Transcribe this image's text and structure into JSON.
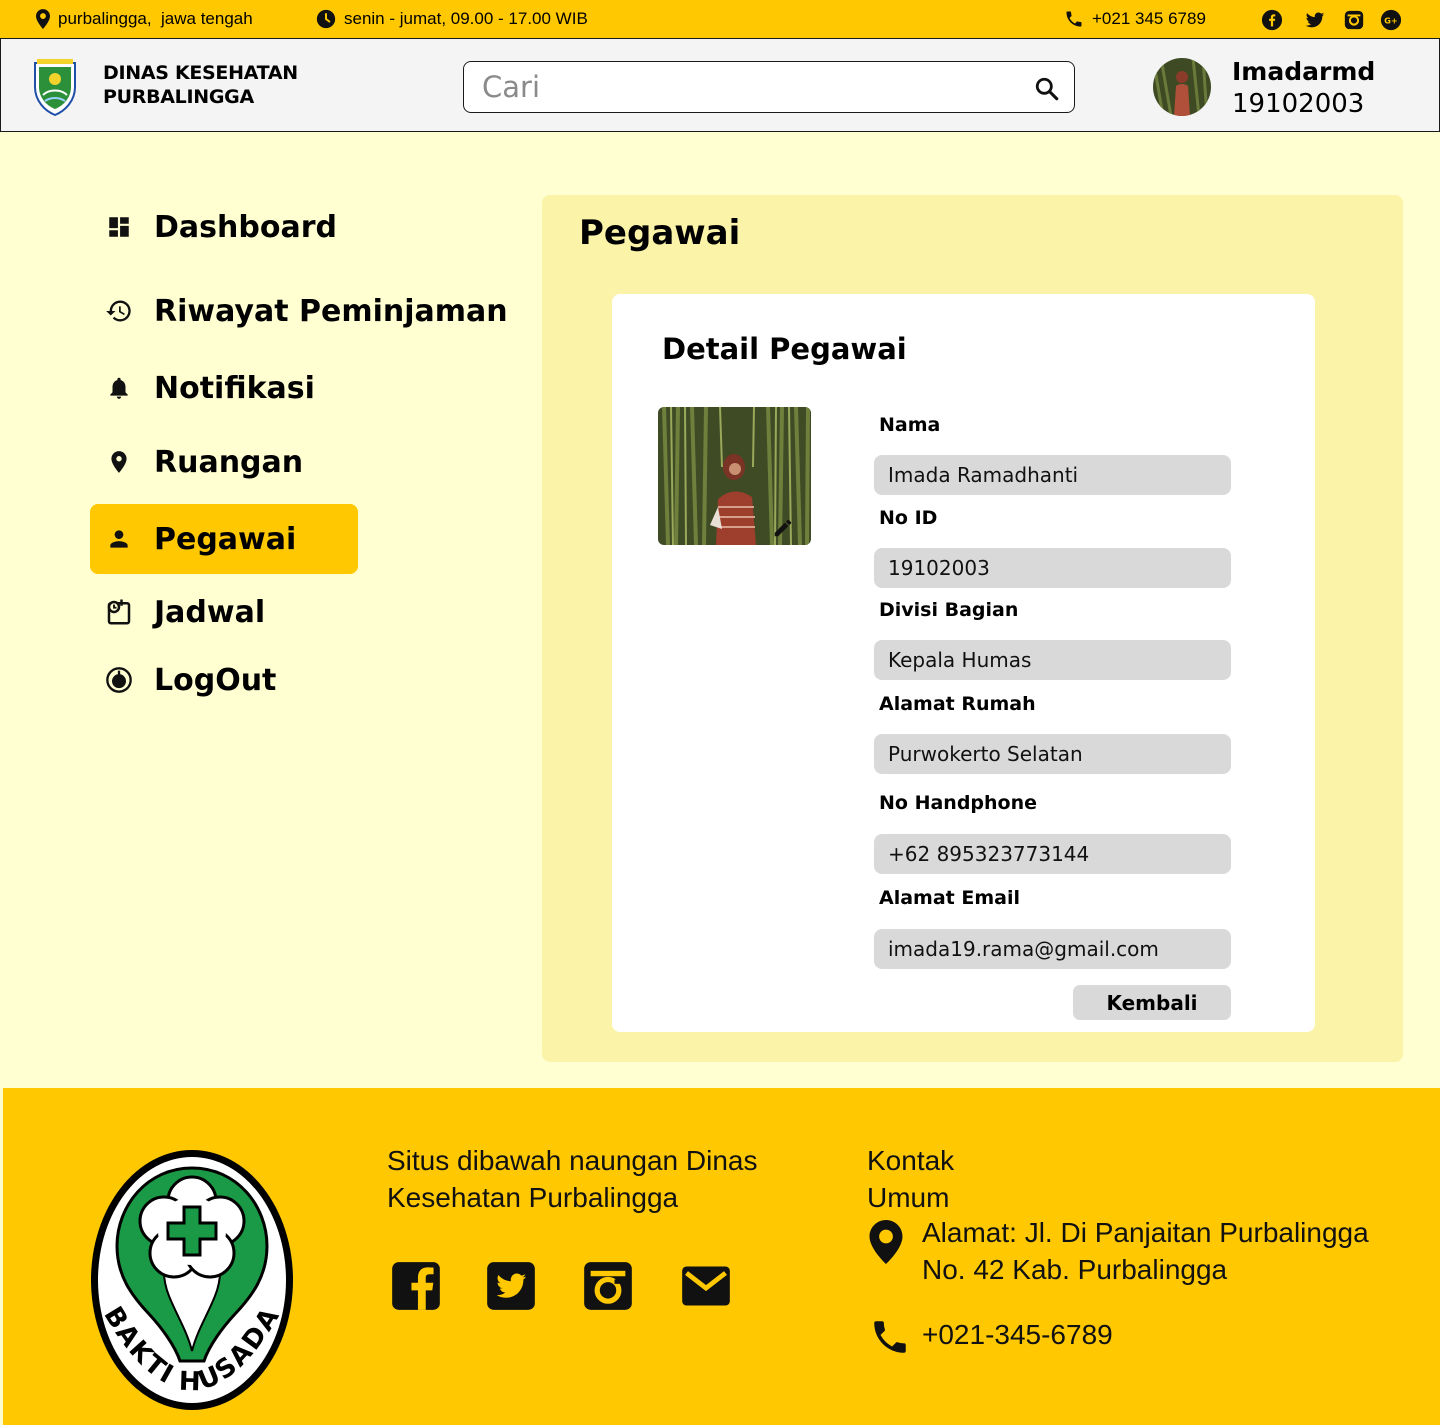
{
  "topbar": {
    "location": "purbalingga,  jawa tengah",
    "hours": "senin - jumat, 09.00 - 17.00 WIB",
    "phone": "+021 345 6789",
    "social_icons": [
      "facebook-icon",
      "twitter-icon",
      "instagram-icon",
      "google-plus-icon"
    ]
  },
  "header": {
    "agency_line1": "DINAS KESEHATAN",
    "agency_line2": "PURBALINGGA",
    "search_placeholder": "Cari",
    "user_name": "Imadarmd",
    "user_id": "19102003"
  },
  "sidebar": {
    "items": [
      {
        "label": "Dashboard",
        "icon": "dashboard-icon"
      },
      {
        "label": "Riwayat Peminjaman",
        "icon": "history-icon"
      },
      {
        "label": "Notifikasi",
        "icon": "bell-icon"
      },
      {
        "label": "Ruangan",
        "icon": "location-pin-icon"
      },
      {
        "label": "Pegawai",
        "icon": "person-icon",
        "active": true
      },
      {
        "label": "Jadwal",
        "icon": "schedule-icon"
      },
      {
        "label": "LogOut",
        "icon": "power-icon"
      }
    ]
  },
  "main": {
    "title": "Pegawai",
    "card_title": "Detail Pegawai",
    "fields": [
      {
        "label": "Nama",
        "value": "Imada Ramadhanti"
      },
      {
        "label": "No ID",
        "value": "19102003"
      },
      {
        "label": "Divisi Bagian",
        "value": "Kepala Humas"
      },
      {
        "label": "Alamat Rumah",
        "value": "Purwokerto Selatan"
      },
      {
        "label": "No Handphone",
        "value": "+62 895323773144"
      },
      {
        "label": "Alamat Email",
        "value": "imada19.rama@gmail.com"
      }
    ],
    "back_button": "Kembali"
  },
  "footer": {
    "emblem_text": "BAKTI HUSADA",
    "about_line1": "Situs dibawah naungan Dinas",
    "about_line2": "Kesehatan Purbalingga",
    "contact_line1": "Kontak",
    "contact_line2": "Umum",
    "address_line1": "Alamat: Jl. Di Panjaitan Purbalingga",
    "address_line2": "No. 42 Kab. Purbalingga",
    "phone": "+021-345-6789",
    "social_icons": [
      "facebook-icon",
      "twitter-icon",
      "instagram-icon",
      "email-icon"
    ]
  },
  "colors": {
    "accent": "#ffc800",
    "background": "#ffffd2",
    "panel": "#fbf3a8",
    "field": "#d9d9d9",
    "emblem_green": "#1a9a46"
  }
}
